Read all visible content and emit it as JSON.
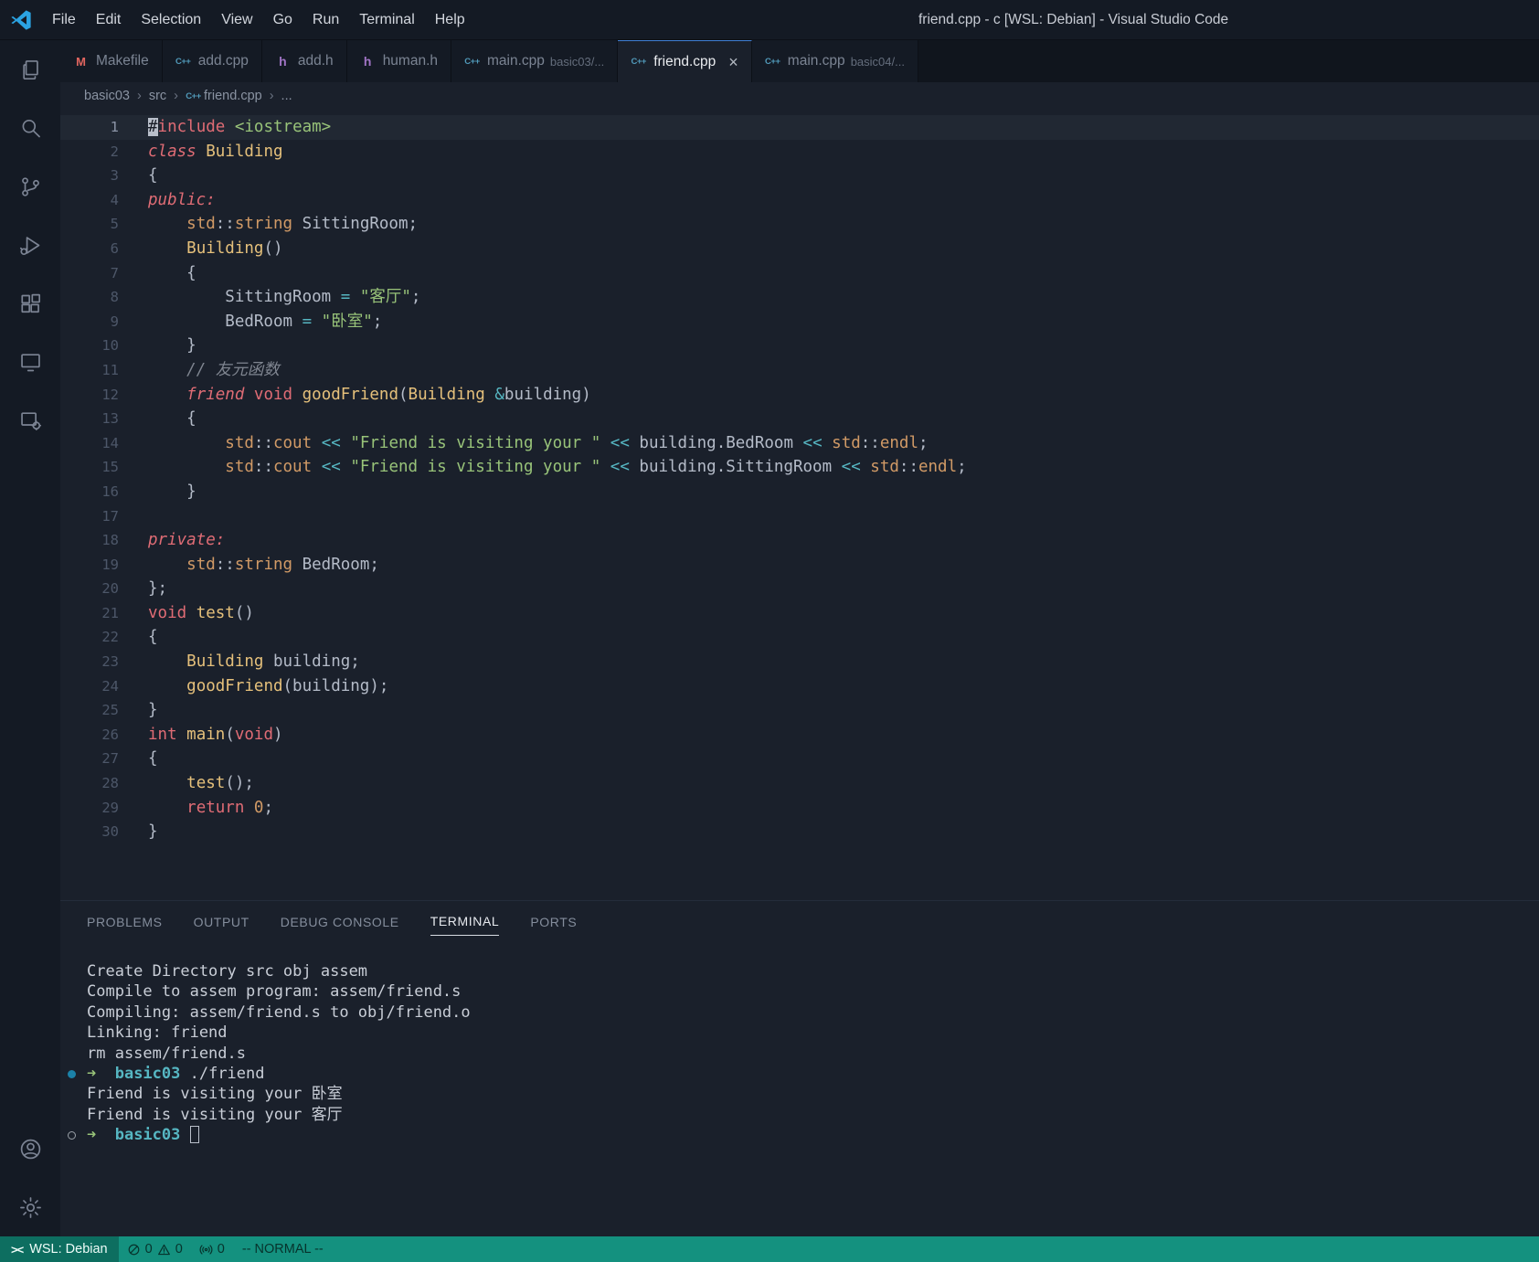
{
  "title_bar": {
    "menus": [
      "File",
      "Edit",
      "Selection",
      "View",
      "Go",
      "Run",
      "Terminal",
      "Help"
    ],
    "title": "friend.cpp - c [WSL: Debian] - Visual Studio Code"
  },
  "ui": {
    "close_glyph": "×"
  },
  "file_icons": {
    "cpp": {
      "glyph": "C++",
      "color": "#519aba",
      "name": "cpp-file-icon"
    },
    "h": {
      "glyph": "h",
      "color": "#a074c4",
      "name": "header-file-icon"
    },
    "make": {
      "glyph": "M",
      "color": "#e0655f",
      "name": "makefile-file-icon"
    }
  },
  "icons": {
    "activity_bar": [
      "explorer-icon",
      "search-icon",
      "source-control-icon",
      "run-debug-icon",
      "extensions-icon",
      "remote-explorer-icon",
      "remote-targets-icon",
      "account-icon",
      "settings-gear-icon"
    ],
    "status_bar": [
      "remote-icon",
      "error-icon",
      "warning-icon",
      "ports-icon"
    ]
  },
  "tabs": [
    {
      "label": "Makefile",
      "icon": "make"
    },
    {
      "label": "add.cpp",
      "icon": "cpp"
    },
    {
      "label": "add.h",
      "icon": "h"
    },
    {
      "label": "human.h",
      "icon": "h"
    },
    {
      "label": "main.cpp",
      "icon": "cpp",
      "desc": "basic03/..."
    },
    {
      "label": "friend.cpp",
      "icon": "cpp",
      "active": true
    },
    {
      "label": "main.cpp",
      "icon": "cpp",
      "desc": "basic04/..."
    }
  ],
  "breadcrumb": {
    "separator": "›",
    "items": [
      {
        "label": "basic03"
      },
      {
        "label": "src"
      },
      {
        "label": "friend.cpp",
        "icon": "cpp"
      },
      {
        "label": "..."
      }
    ]
  },
  "editor": {
    "active_line": 1,
    "lines": [
      [
        [
          "#",
          "cursor"
        ],
        [
          "include",
          "k"
        ],
        [
          " ",
          "p"
        ],
        [
          "<iostream>",
          "s"
        ]
      ],
      [
        [
          "class",
          "ki"
        ],
        [
          " ",
          "p"
        ],
        [
          "Building",
          "t"
        ]
      ],
      [
        [
          "{",
          "p"
        ]
      ],
      [
        [
          "public:",
          "ki"
        ]
      ],
      [
        [
          "    ",
          "p"
        ],
        [
          "std",
          "n"
        ],
        [
          "::",
          "p"
        ],
        [
          "string",
          "n"
        ],
        [
          " SittingRoom;",
          "p"
        ]
      ],
      [
        [
          "    ",
          "p"
        ],
        [
          "Building",
          "t"
        ],
        [
          "()",
          "p"
        ]
      ],
      [
        [
          "    {",
          "p"
        ]
      ],
      [
        [
          "        SittingRoom ",
          "p"
        ],
        [
          "=",
          "o"
        ],
        [
          " ",
          "p"
        ],
        [
          "\"客厅\"",
          "s"
        ],
        [
          ";",
          "p"
        ]
      ],
      [
        [
          "        BedRoom ",
          "p"
        ],
        [
          "=",
          "o"
        ],
        [
          " ",
          "p"
        ],
        [
          "\"卧室\"",
          "s"
        ],
        [
          ";",
          "p"
        ]
      ],
      [
        [
          "    }",
          "p"
        ]
      ],
      [
        [
          "    ",
          "p"
        ],
        [
          "// 友元函数",
          "c"
        ]
      ],
      [
        [
          "    ",
          "p"
        ],
        [
          "friend",
          "ki"
        ],
        [
          " ",
          "p"
        ],
        [
          "void",
          "k"
        ],
        [
          " ",
          "p"
        ],
        [
          "goodFriend",
          "f"
        ],
        [
          "(",
          "p"
        ],
        [
          "Building",
          "t"
        ],
        [
          " ",
          "p"
        ],
        [
          "&",
          "o"
        ],
        [
          "building",
          "p"
        ],
        [
          ")",
          "p"
        ]
      ],
      [
        [
          "    {",
          "p"
        ]
      ],
      [
        [
          "        ",
          "p"
        ],
        [
          "std",
          "n"
        ],
        [
          "::",
          "p"
        ],
        [
          "cout",
          "n"
        ],
        [
          " ",
          "p"
        ],
        [
          "<<",
          "o"
        ],
        [
          " ",
          "p"
        ],
        [
          "\"Friend is visiting your \"",
          "s"
        ],
        [
          " ",
          "p"
        ],
        [
          "<<",
          "o"
        ],
        [
          " building.BedRoom ",
          "p"
        ],
        [
          "<<",
          "o"
        ],
        [
          " ",
          "p"
        ],
        [
          "std",
          "n"
        ],
        [
          "::",
          "p"
        ],
        [
          "endl",
          "n"
        ],
        [
          ";",
          "p"
        ]
      ],
      [
        [
          "        ",
          "p"
        ],
        [
          "std",
          "n"
        ],
        [
          "::",
          "p"
        ],
        [
          "cout",
          "n"
        ],
        [
          " ",
          "p"
        ],
        [
          "<<",
          "o"
        ],
        [
          " ",
          "p"
        ],
        [
          "\"Friend is visiting your \"",
          "s"
        ],
        [
          " ",
          "p"
        ],
        [
          "<<",
          "o"
        ],
        [
          " building.SittingRoom ",
          "p"
        ],
        [
          "<<",
          "o"
        ],
        [
          " ",
          "p"
        ],
        [
          "std",
          "n"
        ],
        [
          "::",
          "p"
        ],
        [
          "endl",
          "n"
        ],
        [
          ";",
          "p"
        ]
      ],
      [
        [
          "    }",
          "p"
        ]
      ],
      [],
      [
        [
          "private:",
          "ki"
        ]
      ],
      [
        [
          "    ",
          "p"
        ],
        [
          "std",
          "n"
        ],
        [
          "::",
          "p"
        ],
        [
          "string",
          "n"
        ],
        [
          " BedRoom;",
          "p"
        ]
      ],
      [
        [
          "};",
          "p"
        ]
      ],
      [
        [
          "void",
          "k"
        ],
        [
          " ",
          "p"
        ],
        [
          "test",
          "f"
        ],
        [
          "()",
          "p"
        ]
      ],
      [
        [
          "{",
          "p"
        ]
      ],
      [
        [
          "    ",
          "p"
        ],
        [
          "Building",
          "t"
        ],
        [
          " building;",
          "p"
        ]
      ],
      [
        [
          "    ",
          "p"
        ],
        [
          "goodFriend",
          "f"
        ],
        [
          "(building);",
          "p"
        ]
      ],
      [
        [
          "}",
          "p"
        ]
      ],
      [
        [
          "int",
          "k"
        ],
        [
          " ",
          "p"
        ],
        [
          "main",
          "f"
        ],
        [
          "(",
          "p"
        ],
        [
          "void",
          "k"
        ],
        [
          ")",
          "p"
        ]
      ],
      [
        [
          "{",
          "p"
        ]
      ],
      [
        [
          "    ",
          "p"
        ],
        [
          "test",
          "f"
        ],
        [
          "();",
          "p"
        ]
      ],
      [
        [
          "    ",
          "p"
        ],
        [
          "return",
          "k"
        ],
        [
          " ",
          "p"
        ],
        [
          "0",
          "num"
        ],
        [
          ";",
          "p"
        ]
      ],
      [
        [
          "}",
          "p"
        ]
      ]
    ]
  },
  "panel": {
    "tabs": [
      "PROBLEMS",
      "OUTPUT",
      "DEBUG CONSOLE",
      "TERMINAL",
      "PORTS"
    ],
    "active_tab": "TERMINAL",
    "terminal_lines": [
      {
        "sp": [
          [
            "Create Directory src obj assem",
            "fg"
          ]
        ]
      },
      {
        "sp": [
          [
            "Compile to assem program: assem/friend.s",
            "fg"
          ]
        ]
      },
      {
        "sp": [
          [
            "Compiling: assem/friend.s to obj/friend.o",
            "fg"
          ]
        ]
      },
      {
        "sp": [
          [
            "Linking: friend",
            "fg"
          ]
        ]
      },
      {
        "sp": [
          [
            "rm assem/friend.s",
            "fg"
          ]
        ]
      },
      {
        "d": "filled",
        "sp": [
          [
            "➜",
            "arrow"
          ],
          [
            "  basic03",
            "dir"
          ],
          [
            " ./friend",
            "fg"
          ]
        ]
      },
      {
        "sp": [
          [
            "Friend is visiting your 卧室",
            "fg"
          ]
        ]
      },
      {
        "sp": [
          [
            "Friend is visiting your 客厅",
            "fg"
          ]
        ]
      },
      {
        "d": "open",
        "sp": [
          [
            "➜",
            "arrow"
          ],
          [
            "  basic03 ",
            "dir"
          ]
        ],
        "cursor": true
      }
    ]
  },
  "status_bar": {
    "remote": "WSL: Debian",
    "errors": "0",
    "warnings": "0",
    "ports": "0",
    "mode": "-- NORMAL --"
  }
}
